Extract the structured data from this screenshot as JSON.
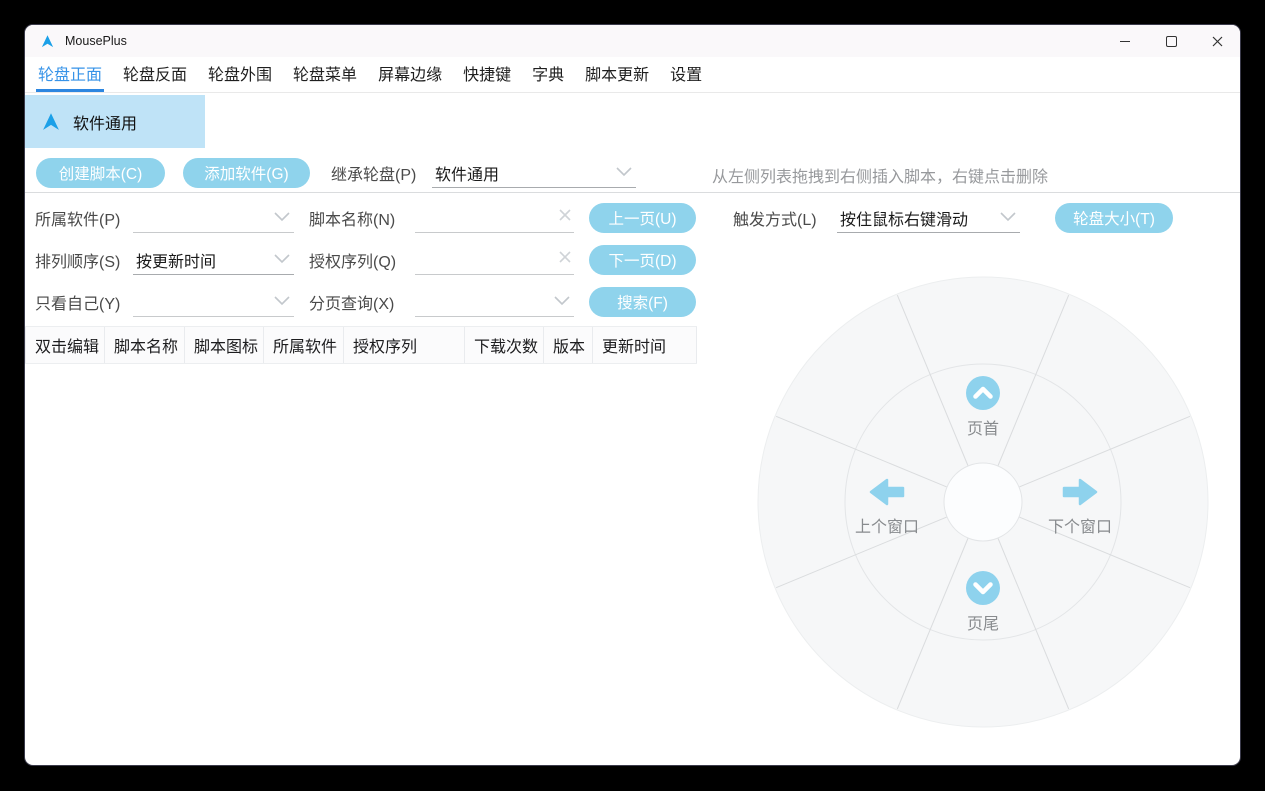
{
  "window": {
    "title": "MousePlus",
    "controls": [
      "minimize",
      "maximize",
      "close"
    ]
  },
  "tabs": {
    "items": [
      {
        "label": "轮盘正面",
        "active": true
      },
      {
        "label": "轮盘反面",
        "active": false
      },
      {
        "label": "轮盘外围",
        "active": false
      },
      {
        "label": "轮盘菜单",
        "active": false
      },
      {
        "label": "屏幕边缘",
        "active": false
      },
      {
        "label": "快捷键",
        "active": false
      },
      {
        "label": "字典",
        "active": false
      },
      {
        "label": "脚本更新",
        "active": false
      },
      {
        "label": "设置",
        "active": false
      }
    ]
  },
  "category": {
    "selected_label": "软件通用",
    "logo_icon": "arrow-cursor-icon"
  },
  "toolbar": {
    "create_script_button": "创建脚本(C)",
    "add_software_button": "添加软件(G)",
    "inherit_wheel_label": "继承轮盘(P)",
    "inherit_wheel_value": "软件通用",
    "drag_hint": "从左侧列表拖拽到右侧插入脚本，右键点击删除"
  },
  "filters": {
    "owner_software_label": "所属软件(P)",
    "owner_software_value": "",
    "script_name_label": "脚本名称(N)",
    "script_name_value": "",
    "sort_order_label": "排列顺序(S)",
    "sort_order_value": "按更新时间",
    "auth_serial_label": "授权序列(Q)",
    "auth_serial_value": "",
    "only_mine_label": "只看自己(Y)",
    "only_mine_value": "",
    "page_query_label": "分页查询(X)",
    "page_query_value": "",
    "prev_page_button": "上一页(U)",
    "next_page_button": "下一页(D)",
    "search_button": "搜索(F)"
  },
  "trigger": {
    "label": "触发方式(L)",
    "value": "按住鼠标右键滑动",
    "wheel_size_button": "轮盘大小(T)"
  },
  "table": {
    "headers": [
      "双击编辑",
      "脚本名称",
      "脚本图标",
      "所属软件",
      "授权序列",
      "下载次数",
      "版本",
      "更新时间"
    ]
  },
  "wheel": {
    "top": {
      "label": "页首",
      "icon": "chevron-up-circle-icon"
    },
    "left": {
      "label": "上个窗口",
      "icon": "arrow-left-icon"
    },
    "right": {
      "label": "下个窗口",
      "icon": "arrow-right-icon"
    },
    "bottom": {
      "label": "页尾",
      "icon": "chevron-down-circle-icon"
    }
  },
  "colors": {
    "accent_blue": "#3693e8",
    "tab_underline": "#2c86e0",
    "logo_blue": "#1ba0e8",
    "selected_bg": "#bfe3f7",
    "button_blue": "#8fd3ec",
    "wheel_bg": "#f6f7f8"
  }
}
